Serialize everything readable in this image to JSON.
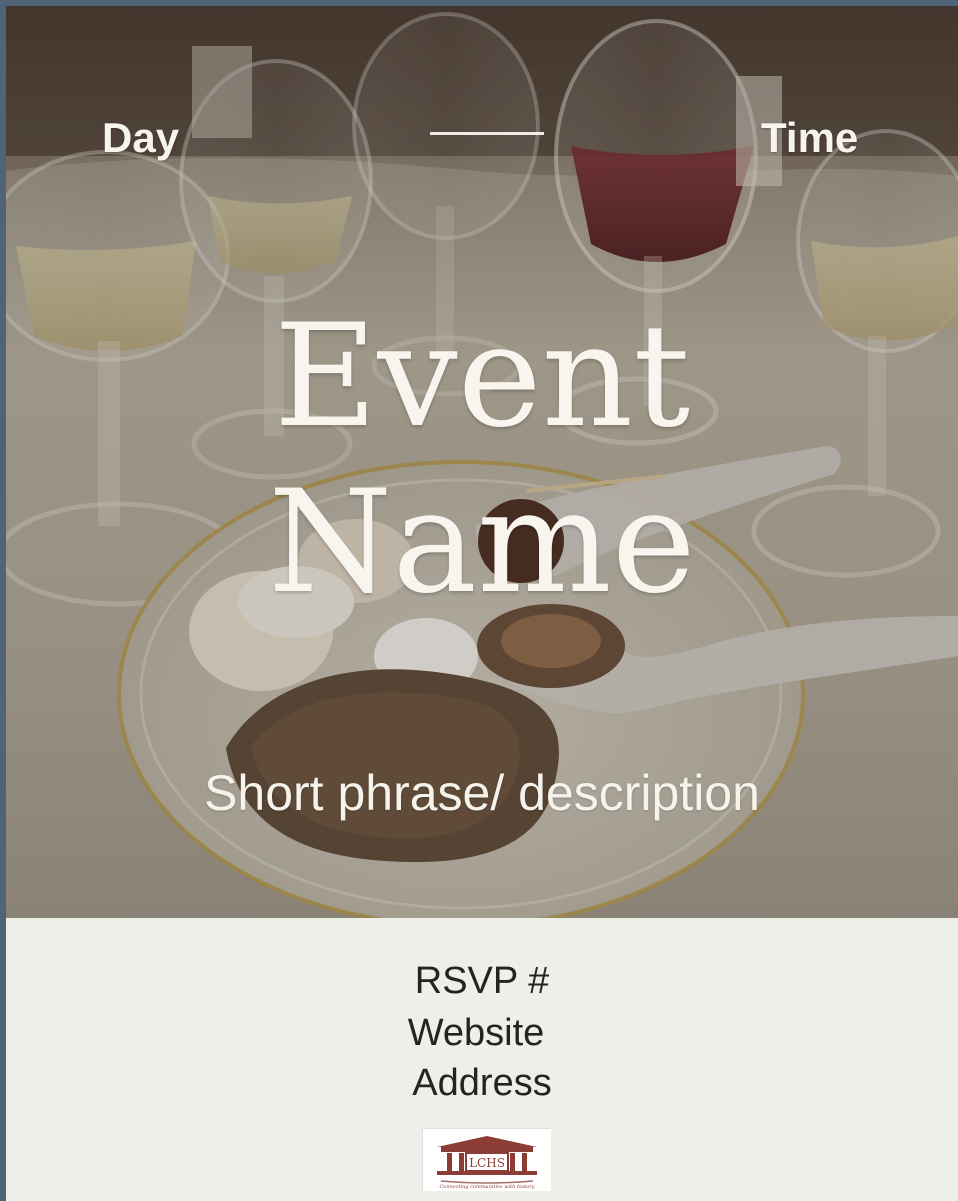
{
  "flyer": {
    "day_label": "Day",
    "time_label": "Time",
    "title_line_1": "Event",
    "title_line_2": "Name",
    "tagline": "Short phrase/ description",
    "rsvp": "RSVP #",
    "website": "Website",
    "address": "Address",
    "logo_text": "LCHS",
    "logo_tagline": "Connecting communities with history"
  },
  "colors": {
    "page_background": "#4f6478",
    "card_background": "#efefea",
    "overlay_text": "#f8f5ef",
    "info_text": "#242424",
    "logo_accent": "#8b3d35"
  },
  "icons": {
    "logo": "lchs-building-logo"
  }
}
